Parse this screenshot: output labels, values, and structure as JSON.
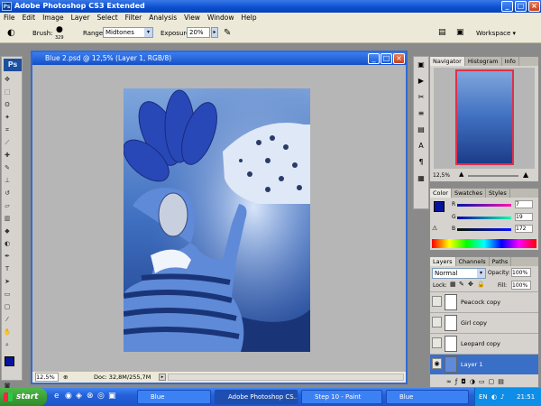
{
  "window": {
    "title": "Adobe Photoshop CS3 Extended",
    "logo": "Ps"
  },
  "menu": [
    "File",
    "Edit",
    "Image",
    "Layer",
    "Select",
    "Filter",
    "Analysis",
    "View",
    "Window",
    "Help"
  ],
  "options": {
    "brush_label": "Brush:",
    "brush_size": "329",
    "range_label": "Range:",
    "range_value": "Midtones",
    "exposure_label": "Exposure:",
    "exposure_value": "20%",
    "workspace_label": "Workspace ▾"
  },
  "document": {
    "title": "Blue 2.psd @ 12,5% (Layer 1, RGB/8)",
    "zoom": "12,5%",
    "doc_info": "Doc: 32,8M/255,7M"
  },
  "navigator": {
    "tabs": [
      "Navigator",
      "Histogram",
      "Info"
    ],
    "zoom": "12,5%"
  },
  "color": {
    "tabs": [
      "Color",
      "Swatches",
      "Styles"
    ],
    "r_label": "R",
    "g_label": "G",
    "b_label": "B",
    "r": "7",
    "g": "19",
    "b": "172",
    "foreground": "#07139c"
  },
  "layers": {
    "tabs": [
      "Layers",
      "Channels",
      "Paths"
    ],
    "blend_mode": "Normal",
    "opacity_label": "Opacity:",
    "opacity": "100%",
    "lock_label": "Lock:",
    "fill_label": "Fill:",
    "fill": "100%",
    "items": [
      {
        "name": "Peacock copy",
        "visible": false,
        "selected": false
      },
      {
        "name": "Girl copy",
        "visible": false,
        "selected": false
      },
      {
        "name": "Leopard copy",
        "visible": false,
        "selected": false
      },
      {
        "name": "Layer 1",
        "visible": true,
        "selected": true
      }
    ]
  },
  "taskbar": {
    "start": "start",
    "tasks": [
      {
        "label": "Blue",
        "active": false
      },
      {
        "label": "Adobe Photoshop CS...",
        "active": true
      },
      {
        "label": "Step 10 - Paint",
        "active": false
      },
      {
        "label": "Blue",
        "active": false
      }
    ],
    "lang": "EN",
    "clock": "21:51"
  },
  "colors": {
    "xp_blue": "#2460d8",
    "accent_selected": "#3a6fc8"
  }
}
